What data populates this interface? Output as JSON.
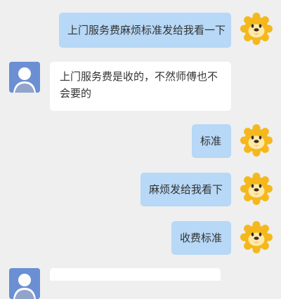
{
  "colors": {
    "background": "#efefef",
    "outgoing_bubble": "#b7d8f6",
    "incoming_bubble": "#ffffff",
    "lion_avatar": "#f5b81c",
    "user_avatar": "#6b8fd3"
  },
  "messages": [
    {
      "sender": "me",
      "avatar_icon": "lion-mascot-icon",
      "text": "上门服务费麻烦标准发给我看一下"
    },
    {
      "sender": "other",
      "avatar_icon": "default-user-icon",
      "text": "上门服务费是收的，不然师傅也不会要的"
    },
    {
      "sender": "me",
      "avatar_icon": "lion-mascot-icon",
      "text": "标准"
    },
    {
      "sender": "me",
      "avatar_icon": "lion-mascot-icon",
      "text": "麻烦发给我看下"
    },
    {
      "sender": "me",
      "avatar_icon": "lion-mascot-icon",
      "text": "收费标准"
    },
    {
      "sender": "other",
      "avatar_icon": "default-user-icon",
      "text": ""
    }
  ]
}
